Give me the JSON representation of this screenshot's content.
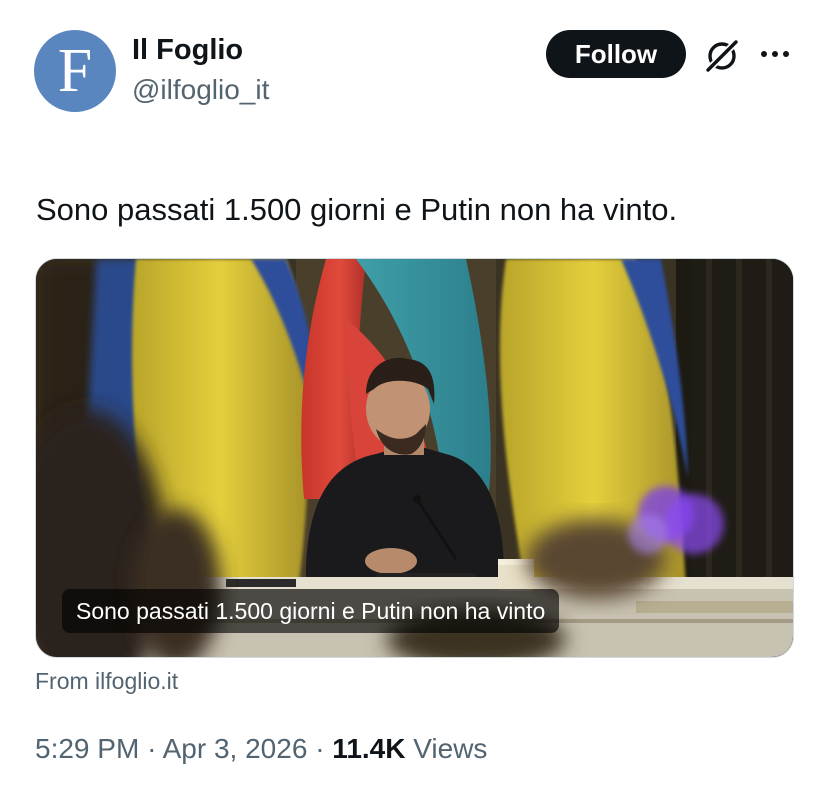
{
  "author": {
    "avatar_letter": "F",
    "display_name": "Il Foglio",
    "handle": "@ilfoglio_it"
  },
  "actions": {
    "follow_label": "Follow",
    "grok_icon": "grok-icon",
    "more_icon": "more-icon"
  },
  "tweet": {
    "text": "Sono passati 1.500 giorni e Putin non ha vinto.",
    "card_caption": "Sono passati 1.500 giorni e Putin non ha vinto",
    "card_source": "From ilfoglio.it"
  },
  "meta": {
    "time": "5:29 PM",
    "separator": "·",
    "date": "Apr 3, 2026",
    "views_count": "11.4K",
    "views_label": "Views"
  },
  "colors": {
    "avatar_bg": "#5a86bf",
    "follow_bg": "#0f1419",
    "secondary_text": "#536471"
  }
}
